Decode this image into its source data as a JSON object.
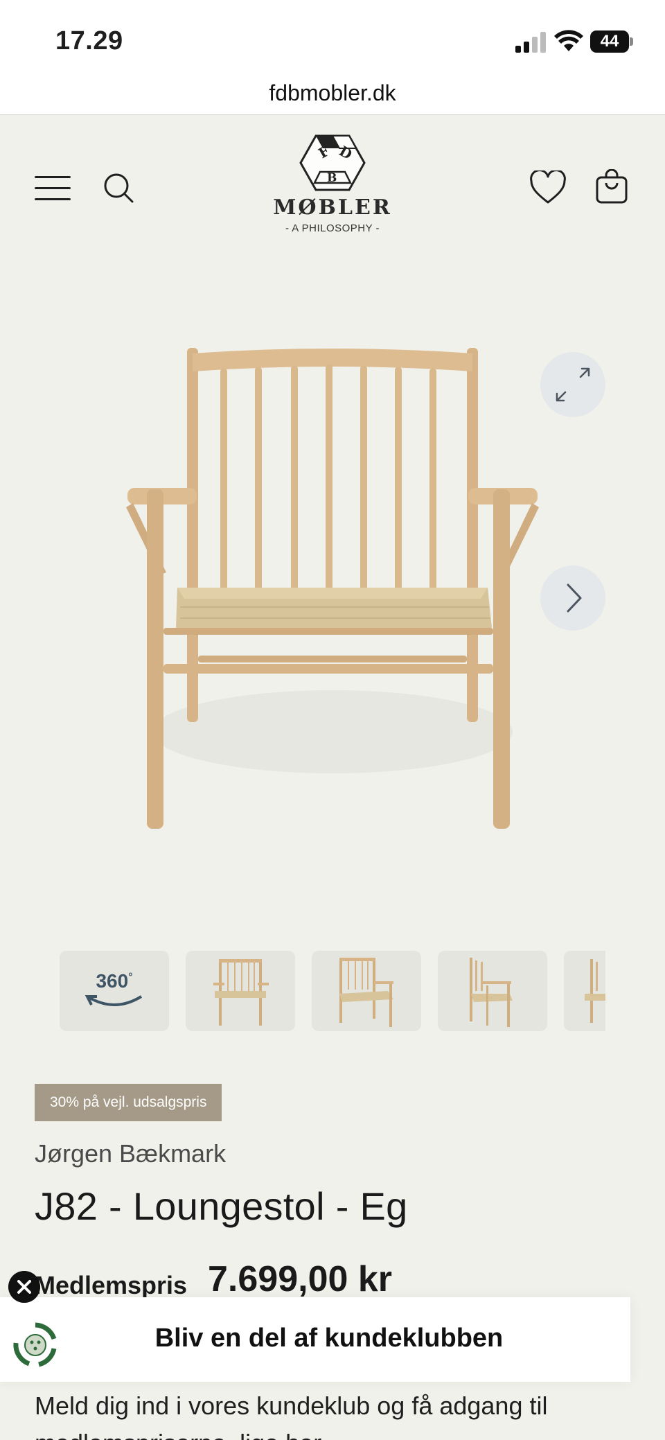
{
  "status_bar": {
    "time": "17.29",
    "battery": "44"
  },
  "browser": {
    "url": "fdbmobler.dk"
  },
  "header": {
    "logo_name": "MØBLER",
    "logo_tagline": "- A PHILOSOPHY -"
  },
  "gallery": {
    "thumb_360_label": "360"
  },
  "product": {
    "badge": "30% på vejl. udsalgspris",
    "designer": "Jørgen Bækmark",
    "title": "J82 - Loungestol - Eg",
    "price_label": "Medlemspris",
    "price_value": "7.699,00 kr"
  },
  "club_popup": {
    "title": "Bliv en del af kundeklubben"
  },
  "description": {
    "text": "Meld dig ind i vores kundeklub og få adgang til medlemspriserne, lige her."
  },
  "colors": {
    "background": "#f1f1ec",
    "badge": "#a59a88",
    "wood": "#d8b98c",
    "button": "#e5e8ea"
  }
}
